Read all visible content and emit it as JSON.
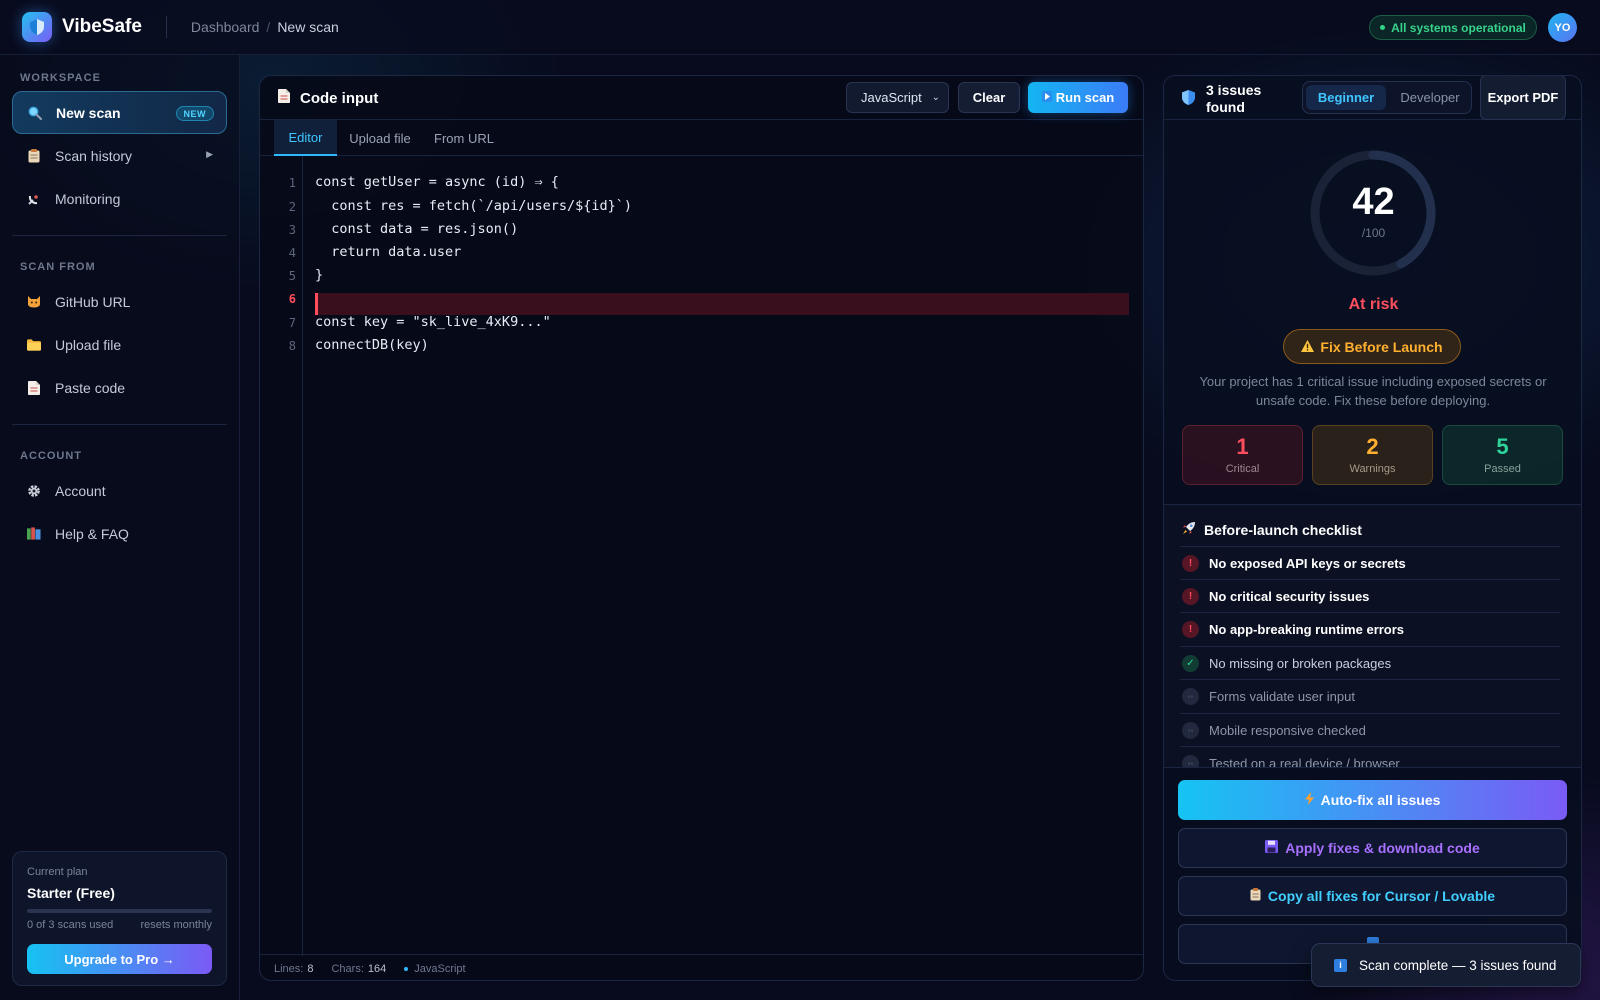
{
  "app": {
    "name": "VibeSafe",
    "breadcrumb": [
      "Dashboard",
      "New scan"
    ],
    "breadcrumb_sep": "/",
    "status": "All systems operational",
    "avatar_initials": "YO"
  },
  "sidebar": {
    "workspace_label": "WORKSPACE",
    "workspace_items": [
      {
        "label": "New scan",
        "icon": "magnifier-icon",
        "badge": "NEW",
        "active": true
      },
      {
        "label": "Scan history",
        "icon": "clipboard-icon",
        "expandable": true
      },
      {
        "label": "Monitoring",
        "icon": "satellite-icon"
      }
    ],
    "scan_from_label": "SCAN FROM",
    "scan_from_items": [
      {
        "label": "GitHub URL",
        "icon": "cat-icon"
      },
      {
        "label": "Upload file",
        "icon": "folder-icon"
      },
      {
        "label": "Paste code",
        "icon": "document-icon"
      }
    ],
    "account_label": "ACCOUNT",
    "account_items": [
      {
        "label": "Account",
        "icon": "gear-icon"
      },
      {
        "label": "Help & FAQ",
        "icon": "books-icon"
      }
    ],
    "plan": {
      "label": "Current plan",
      "name": "Starter (Free)",
      "usage": "0 of 3 scans used",
      "usage_fraction": 0,
      "reset": "resets monthly",
      "upgrade": "Upgrade to Pro →"
    }
  },
  "editor": {
    "title": "Code input",
    "language": "JavaScript",
    "clear_label": "Clear",
    "run_label": "Run scan",
    "tabs": [
      "Editor",
      "Upload file",
      "From URL"
    ],
    "active_tab": 0,
    "lines": [
      "const getUser = async (id) ⇒ {",
      "  const res = fetch(`/api/users/${id}`)",
      "  const data = res.json()",
      "  return data.user",
      "}",
      "",
      "const key = \"sk_live_4xK9...\"",
      "connectDB(key)"
    ],
    "error_line": 6,
    "footer": {
      "lines_label": "Lines:",
      "lines_value": "8",
      "chars_label": "Chars:",
      "chars_value": "164",
      "language": "JavaScript"
    }
  },
  "results": {
    "issues_title": "3 issues found",
    "mode_options": [
      "Beginner",
      "Developer"
    ],
    "active_mode": 0,
    "export_label": "Export PDF",
    "score": "42",
    "score_of": "/100",
    "score_value": 42,
    "risk_label": "At risk",
    "fix_badge": "Fix Before Launch",
    "description": "Your project has 1 critical issue including exposed secrets or unsafe code. Fix these before deploying.",
    "stats": [
      {
        "value": "1",
        "label": "Critical"
      },
      {
        "value": "2",
        "label": "Warnings"
      },
      {
        "value": "5",
        "label": "Passed"
      }
    ],
    "checklist_title": "Before-launch checklist",
    "checklist": [
      {
        "label": "No exposed API keys or secrets",
        "state": "fail"
      },
      {
        "label": "No critical security issues",
        "state": "fail"
      },
      {
        "label": "No app-breaking runtime errors",
        "state": "fail"
      },
      {
        "label": "No missing or broken packages",
        "state": "pass"
      },
      {
        "label": "Forms validate user input",
        "state": "pending"
      },
      {
        "label": "Mobile responsive checked",
        "state": "pending"
      },
      {
        "label": "Tested on a real device / browser",
        "state": "pending"
      }
    ],
    "actions": {
      "autofix": "Auto-fix all issues",
      "apply": "Apply fixes & download code",
      "copy": "Copy all fixes for Cursor / Lovable"
    }
  },
  "toast": {
    "message": "Scan complete — 3 issues found"
  },
  "colors": {
    "accent_cyan": "#2fb8ff",
    "accent_purple": "#7a5bf5",
    "critical": "#ff4d5e",
    "warning": "#ffb02e",
    "passed": "#2ed39a"
  }
}
